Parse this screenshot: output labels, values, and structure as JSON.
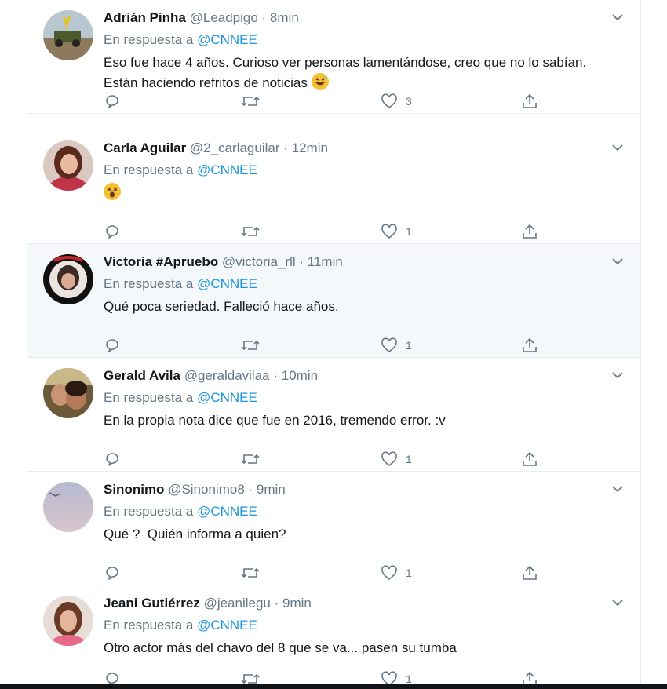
{
  "reply_prefix": "En respuesta a",
  "tweets": [
    {
      "name": "Adrián Pinha",
      "handle": "@Leadpigo",
      "time": "· 8min",
      "reply_to": "@CNNEE",
      "text": "Eso fue hace 4 años. Curioso ver personas lamentándose, creo que no lo sabían. Están haciendo refritos de noticias",
      "emoji": "grinning-sweat-emoji",
      "likes": "3",
      "highlighted": false
    },
    {
      "name": "Carla Aguilar",
      "handle": "@2_carlaguilar",
      "time": "· 12min",
      "reply_to": "@CNNEE",
      "text": "",
      "emoji": "astonished-face-emoji",
      "likes": "1",
      "highlighted": false
    },
    {
      "name": "Victoria #Apruebo",
      "handle": "@victoria_rll",
      "time": "· 11min",
      "reply_to": "@CNNEE",
      "text": "Qué poca seriedad. Falleció hace años.",
      "likes": "1",
      "highlighted": true
    },
    {
      "name": "Gerald Avila",
      "handle": "@geraldavilaa",
      "time": "· 10min",
      "reply_to": "@CNNEE",
      "text": "En la propia nota dice que fue en 2016, tremendo error. :v",
      "likes": "1",
      "highlighted": false
    },
    {
      "name": "Sinonimo",
      "handle": "@Sinonimo8",
      "time": "· 9min",
      "reply_to": "@CNNEE",
      "text": "Qué ?  Quién informa a quien?",
      "likes": "1",
      "highlighted": false
    },
    {
      "name": "Jeani Gutiérrez",
      "handle": "@jeanilegu",
      "time": "· 9min",
      "reply_to": "@CNNEE",
      "text": "Otro actor más del chavo del 8 que se va... pasen su tumba",
      "likes": "1",
      "highlighted": false
    }
  ],
  "icons": {
    "reply": "reply-icon",
    "retweet": "retweet-icon",
    "like": "heart-icon",
    "share": "share-icon",
    "more": "chevron-down-icon"
  },
  "colors": {
    "link": "#1b95e0",
    "muted": "#657786",
    "highlight_bg": "#f5f8fa",
    "divider": "#e6ecf0"
  }
}
